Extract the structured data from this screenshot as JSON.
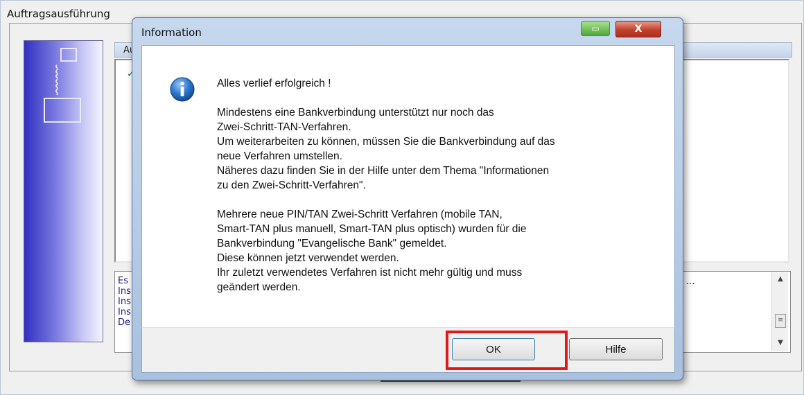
{
  "background_window": {
    "title": "Auftragsausführung",
    "list_header": "Au",
    "list_check": "✓",
    "log_lines": [
      "Es",
      "Ins",
      "Ins",
      "Ins",
      "De"
    ],
    "log_right_text": "n ...",
    "scroll_up": "▲",
    "scroll_grip": "≡",
    "scroll_down": "▼"
  },
  "dialog": {
    "title": "Information",
    "minimize_label": "▭",
    "close_label": "X",
    "messages": [
      "Alles verlief erfolgreich !",
      "Mindestens eine Bankverbindung unterstützt nur noch das\nZwei-Schritt-TAN-Verfahren.\nUm weiterarbeiten zu können, müssen Sie die Bankverbindung auf das\nneue Verfahren umstellen.\nNäheres dazu finden Sie in der Hilfe unter dem Thema \"Informationen\nzu den Zwei-Schritt-Verfahren\".",
      "Mehrere neue PIN/TAN Zwei-Schritt Verfahren (mobile TAN,\nSmart-TAN plus manuell, Smart-TAN plus optisch) wurden für die\nBankverbindung \"Evangelische Bank\" gemeldet.\nDiese können jetzt verwendet werden.\nIhr zuletzt verwendetes Verfahren ist nicht mehr gültig und muss\ngeändert werden."
    ],
    "ok_label": "OK",
    "help_label": "Hilfe"
  },
  "colors": {
    "highlight": "#e01818",
    "info_icon": "#1f63b8"
  },
  "icons": [
    "info-icon",
    "minimize-icon",
    "close-icon"
  ]
}
